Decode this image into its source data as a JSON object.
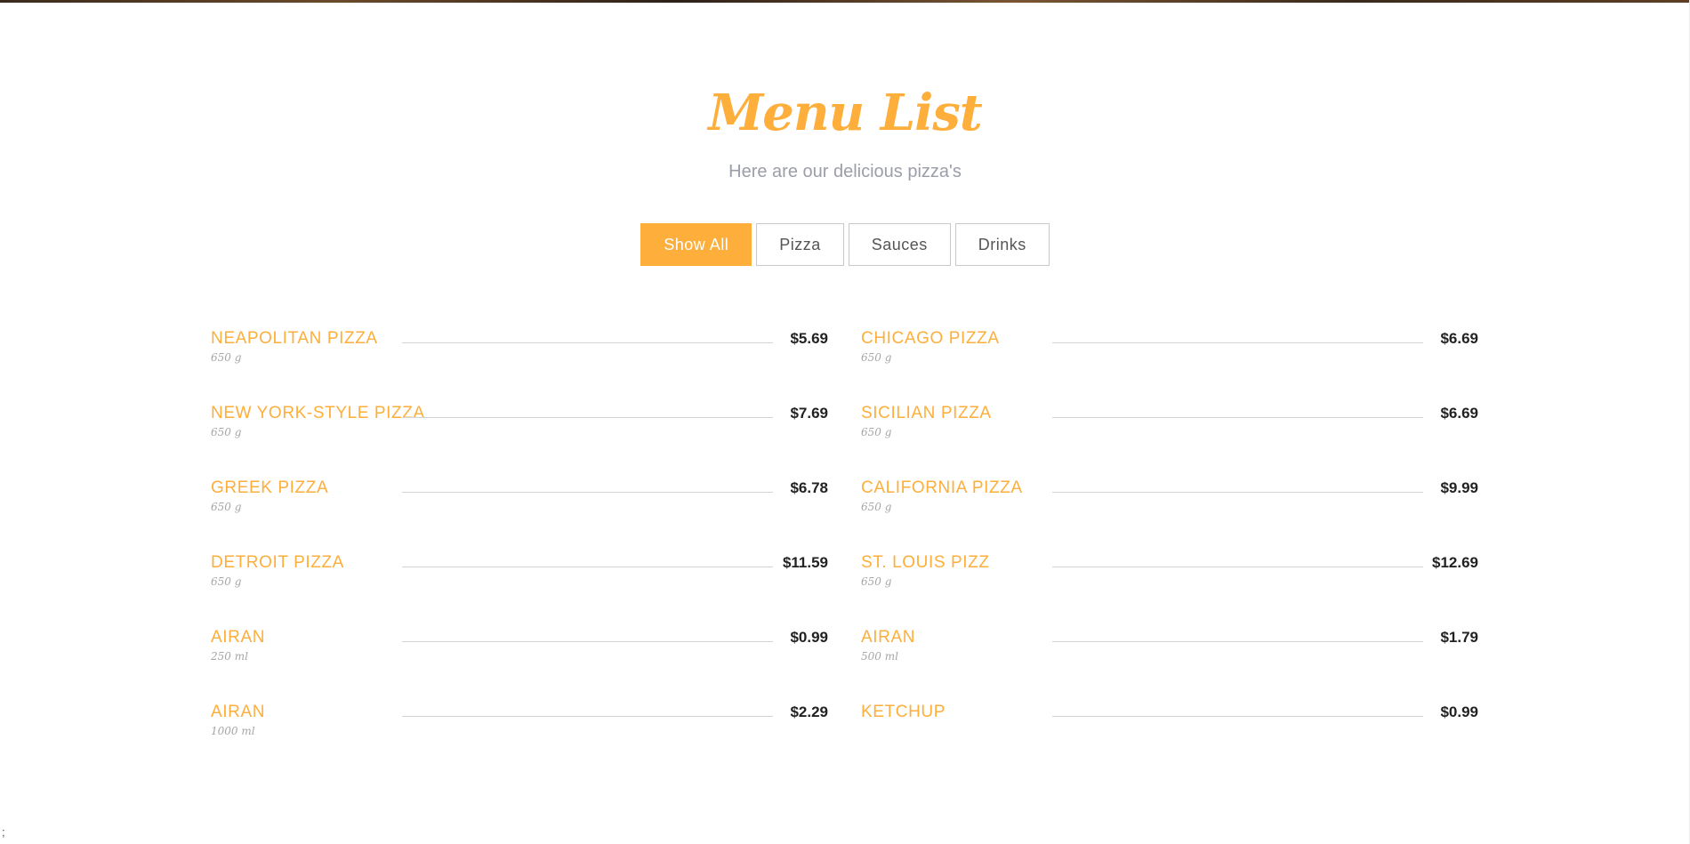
{
  "header": {
    "title": "Menu List",
    "subtitle": "Here are our delicious pizza's"
  },
  "filters": [
    {
      "label": "Show All",
      "active": true
    },
    {
      "label": "Pizza",
      "active": false
    },
    {
      "label": "Sauces",
      "active": false
    },
    {
      "label": "Drinks",
      "active": false
    }
  ],
  "menu": {
    "left": [
      {
        "name": "NEAPOLITAN PIZZA",
        "weight": "650 g",
        "price": "$5.69"
      },
      {
        "name": "NEW YORK-STYLE PIZZA",
        "weight": "650 g",
        "price": "$7.69"
      },
      {
        "name": "GREEK PIZZA",
        "weight": "650 g",
        "price": "$6.78"
      },
      {
        "name": "DETROIT PIZZA",
        "weight": "650 g",
        "price": "$11.59"
      },
      {
        "name": "AIRAN",
        "weight": "250 ml",
        "price": "$0.99"
      },
      {
        "name": "AIRAN",
        "weight": "1000 ml",
        "price": "$2.29"
      }
    ],
    "right": [
      {
        "name": "CHICAGO PIZZA",
        "weight": "650 g",
        "price": "$6.69"
      },
      {
        "name": "SICILIAN PIZZA",
        "weight": "650 g",
        "price": "$6.69"
      },
      {
        "name": "CALIFORNIA PIZZA",
        "weight": "650 g",
        "price": "$9.99"
      },
      {
        "name": "ST. LOUIS PIZZ",
        "weight": "650 g",
        "price": "$12.69"
      },
      {
        "name": "AIRAN",
        "weight": "500 ml",
        "price": "$1.79"
      },
      {
        "name": "KETCHUP",
        "weight": "",
        "price": "$0.99"
      }
    ]
  },
  "footer": {
    "stray_text": ";"
  },
  "colors": {
    "accent": "#fdae3b",
    "subtitle": "#9b9ea8",
    "price": "#222222",
    "weight": "#a6a6a6",
    "divider": "#d4d4d4"
  }
}
